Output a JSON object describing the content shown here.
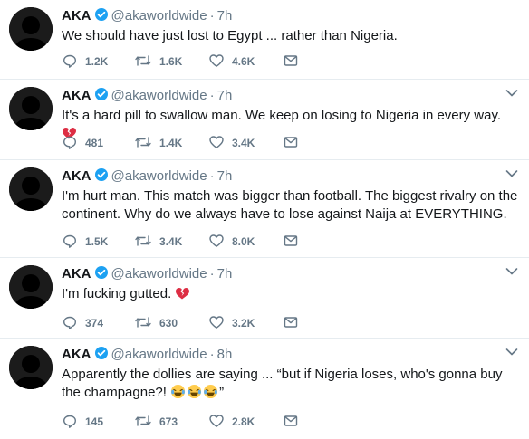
{
  "tweets": [
    {
      "name": "AKA",
      "handle": "@akaworldwide",
      "dot": "·",
      "time": "7h",
      "text": "We should have just lost to Egypt ... rather than Nigeria.",
      "emoji": "",
      "replies": "1.2K",
      "retweets": "1.6K",
      "likes": "4.6K",
      "has_menu": false
    },
    {
      "name": "AKA",
      "handle": "@akaworldwide",
      "dot": "·",
      "time": "7h",
      "text": "It's a hard pill to swallow man. We keep on losing to Nigeria in every way.",
      "emoji": "broken-heart",
      "replies": "481",
      "retweets": "1.4K",
      "likes": "3.4K",
      "has_menu": true
    },
    {
      "name": "AKA",
      "handle": "@akaworldwide",
      "dot": "·",
      "time": "7h",
      "text": "I'm hurt man. This match was bigger than football. The biggest rivalry on the continent. Why do we always have to lose against Naija at EVERYTHING.",
      "emoji": "",
      "replies": "1.5K",
      "retweets": "3.4K",
      "likes": "8.0K",
      "has_menu": true
    },
    {
      "name": "AKA",
      "handle": "@akaworldwide",
      "dot": "·",
      "time": "7h",
      "text": "I'm fucking gutted.",
      "emoji": "broken-heart",
      "replies": "374",
      "retweets": "630",
      "likes": "3.2K",
      "has_menu": true
    },
    {
      "name": "AKA",
      "handle": "@akaworldwide",
      "dot": "·",
      "time": "8h",
      "text": "Apparently the dollies are saying ... “but if Nigeria loses, who's gonna buy the champagne?!",
      "emoji": "laughing-tears-x3",
      "text_after": "”",
      "replies": "145",
      "retweets": "673",
      "likes": "2.8K",
      "has_menu": true
    }
  ],
  "icons": {
    "verified_color": "#1da1f2",
    "action_color": "#657786",
    "broken_heart_color": "#dd2e44",
    "reply": "reply-icon",
    "retweet": "retweet-icon",
    "like": "heart-icon",
    "dm": "envelope-icon",
    "menu": "chevron-down-icon"
  }
}
